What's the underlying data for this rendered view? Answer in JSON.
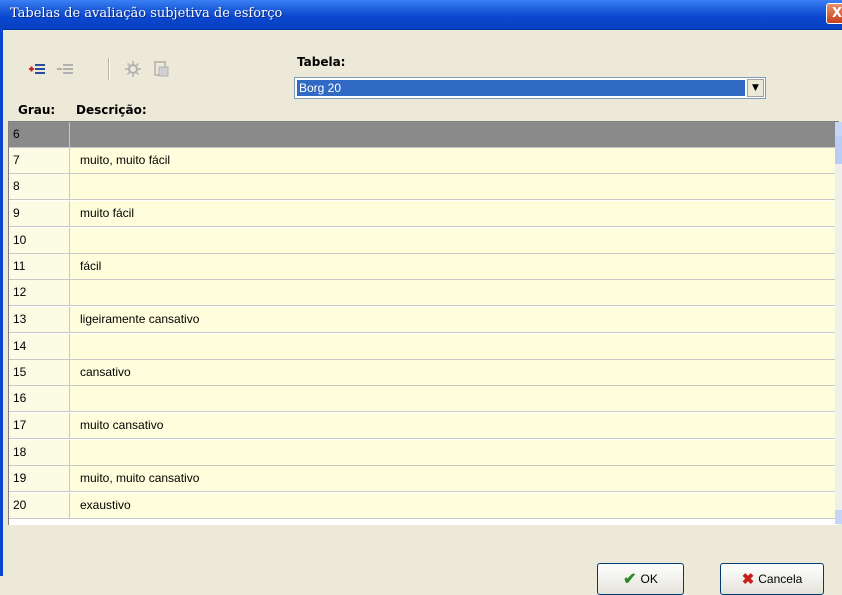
{
  "window": {
    "title": "Tabelas de avaliação subjetiva de esforço",
    "close_label": "X"
  },
  "toolbar": {
    "buttons": [
      {
        "icon": "add-row-icon",
        "enabled": true
      },
      {
        "icon": "remove-row-icon",
        "enabled": false
      },
      {
        "icon": "settings-icon",
        "enabled": false
      },
      {
        "icon": "export-icon",
        "enabled": false
      }
    ]
  },
  "tabela": {
    "label": "Tabela:",
    "selected": "Borg 20"
  },
  "grid": {
    "headers": {
      "grau": "Grau:",
      "descricao": "Descrição:"
    },
    "rows": [
      {
        "grau": "6",
        "descricao": ""
      },
      {
        "grau": "7",
        "descricao": "muito, muito fácil"
      },
      {
        "grau": "8",
        "descricao": ""
      },
      {
        "grau": "9",
        "descricao": "muito fácil"
      },
      {
        "grau": "10",
        "descricao": ""
      },
      {
        "grau": "11",
        "descricao": "fácil"
      },
      {
        "grau": "12",
        "descricao": ""
      },
      {
        "grau": "13",
        "descricao": "ligeiramente cansativo"
      },
      {
        "grau": "14",
        "descricao": ""
      },
      {
        "grau": "15",
        "descricao": "cansativo"
      },
      {
        "grau": "16",
        "descricao": ""
      },
      {
        "grau": "17",
        "descricao": "muito cansativo"
      },
      {
        "grau": "18",
        "descricao": ""
      },
      {
        "grau": "19",
        "descricao": "muito, muito cansativo"
      },
      {
        "grau": "20",
        "descricao": "exaustivo"
      }
    ],
    "selected_index": 0
  },
  "buttons": {
    "ok_label": "OK",
    "cancel_label": "Cancela"
  },
  "colors": {
    "titlebar": "#0a46d0",
    "selection": "#316ac5",
    "row_background": "#fffedc",
    "selected_row": "#8a8a8a"
  }
}
